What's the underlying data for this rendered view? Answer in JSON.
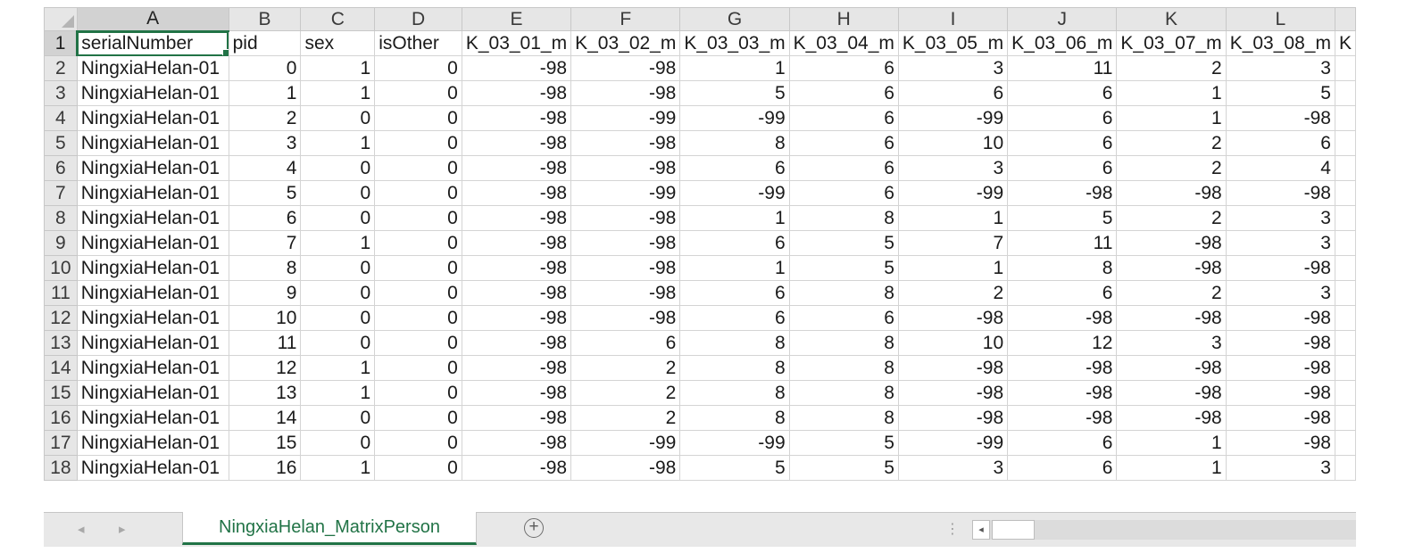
{
  "columns": [
    "A",
    "B",
    "C",
    "D",
    "E",
    "F",
    "G",
    "H",
    "I",
    "J",
    "K",
    "L"
  ],
  "header_row": {
    "number": "1",
    "cells": [
      "serialNumber",
      "pid",
      "sex",
      "isOther",
      "K_03_01_m",
      "K_03_02_m",
      "K_03_03_m",
      "K_03_04_m",
      "K_03_05_m",
      "K_03_06_m",
      "K_03_07_m",
      "K_03_08_m"
    ],
    "overflow": "K"
  },
  "rows": [
    {
      "n": "2",
      "cells": [
        "NingxiaHelan-01",
        "0",
        "1",
        "0",
        "-98",
        "-98",
        "1",
        "6",
        "3",
        "11",
        "2",
        "3"
      ]
    },
    {
      "n": "3",
      "cells": [
        "NingxiaHelan-01",
        "1",
        "1",
        "0",
        "-98",
        "-98",
        "5",
        "6",
        "6",
        "6",
        "1",
        "5"
      ]
    },
    {
      "n": "4",
      "cells": [
        "NingxiaHelan-01",
        "2",
        "0",
        "0",
        "-98",
        "-99",
        "-99",
        "6",
        "-99",
        "6",
        "1",
        "-98"
      ]
    },
    {
      "n": "5",
      "cells": [
        "NingxiaHelan-01",
        "3",
        "1",
        "0",
        "-98",
        "-98",
        "8",
        "6",
        "10",
        "6",
        "2",
        "6"
      ]
    },
    {
      "n": "6",
      "cells": [
        "NingxiaHelan-01",
        "4",
        "0",
        "0",
        "-98",
        "-98",
        "6",
        "6",
        "3",
        "6",
        "2",
        "4"
      ]
    },
    {
      "n": "7",
      "cells": [
        "NingxiaHelan-01",
        "5",
        "0",
        "0",
        "-98",
        "-99",
        "-99",
        "6",
        "-99",
        "-98",
        "-98",
        "-98"
      ]
    },
    {
      "n": "8",
      "cells": [
        "NingxiaHelan-01",
        "6",
        "0",
        "0",
        "-98",
        "-98",
        "1",
        "8",
        "1",
        "5",
        "2",
        "3"
      ]
    },
    {
      "n": "9",
      "cells": [
        "NingxiaHelan-01",
        "7",
        "1",
        "0",
        "-98",
        "-98",
        "6",
        "5",
        "7",
        "11",
        "-98",
        "3"
      ]
    },
    {
      "n": "10",
      "cells": [
        "NingxiaHelan-01",
        "8",
        "0",
        "0",
        "-98",
        "-98",
        "1",
        "5",
        "1",
        "8",
        "-98",
        "-98"
      ]
    },
    {
      "n": "11",
      "cells": [
        "NingxiaHelan-01",
        "9",
        "0",
        "0",
        "-98",
        "-98",
        "6",
        "8",
        "2",
        "6",
        "2",
        "3"
      ]
    },
    {
      "n": "12",
      "cells": [
        "NingxiaHelan-01",
        "10",
        "0",
        "0",
        "-98",
        "-98",
        "6",
        "6",
        "-98",
        "-98",
        "-98",
        "-98"
      ]
    },
    {
      "n": "13",
      "cells": [
        "NingxiaHelan-01",
        "11",
        "0",
        "0",
        "-98",
        "6",
        "8",
        "8",
        "10",
        "12",
        "3",
        "-98"
      ]
    },
    {
      "n": "14",
      "cells": [
        "NingxiaHelan-01",
        "12",
        "1",
        "0",
        "-98",
        "2",
        "8",
        "8",
        "-98",
        "-98",
        "-98",
        "-98"
      ]
    },
    {
      "n": "15",
      "cells": [
        "NingxiaHelan-01",
        "13",
        "1",
        "0",
        "-98",
        "2",
        "8",
        "8",
        "-98",
        "-98",
        "-98",
        "-98"
      ]
    },
    {
      "n": "16",
      "cells": [
        "NingxiaHelan-01",
        "14",
        "0",
        "0",
        "-98",
        "2",
        "8",
        "8",
        "-98",
        "-98",
        "-98",
        "-98"
      ]
    },
    {
      "n": "17",
      "cells": [
        "NingxiaHelan-01",
        "15",
        "0",
        "0",
        "-98",
        "-99",
        "-99",
        "5",
        "-99",
        "6",
        "1",
        "-98"
      ]
    },
    {
      "n": "18",
      "cells": [
        "NingxiaHelan-01",
        "16",
        "1",
        "0",
        "-98",
        "-98",
        "5",
        "5",
        "3",
        "6",
        "1",
        "3"
      ]
    }
  ],
  "sheet_tab": {
    "label": "NingxiaHelan_MatrixPerson"
  },
  "icons": {
    "prev": "triangle-left",
    "next": "triangle-right",
    "add": "plus-circle",
    "split": "vertical-dots"
  },
  "symbols": {
    "prev": "◂",
    "next": "▸",
    "add": "+",
    "split": "⋮",
    "scroll_left": "◂"
  },
  "colors": {
    "accent": "#217346",
    "header_bg": "#e6e6e6",
    "grid_line": "#d4d4d4"
  }
}
